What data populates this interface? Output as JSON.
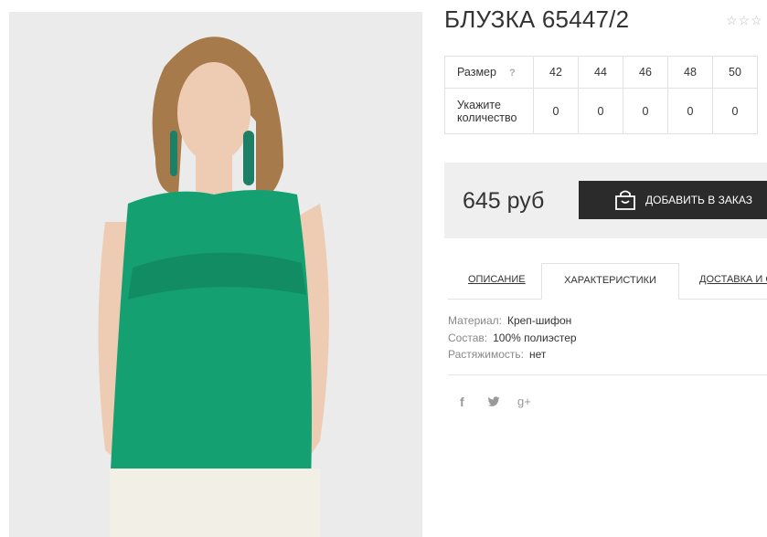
{
  "product": {
    "title": "БЛУЗКА 65447/2",
    "rating_stars": "☆☆☆",
    "rating_value": 0
  },
  "size_table": {
    "size_label": "Размер",
    "help_icon": "?",
    "sizes": [
      "42",
      "44",
      "46",
      "48",
      "50"
    ],
    "qty_label_line1": "Укажите",
    "qty_label_line2": "количество",
    "quantities": [
      "0",
      "0",
      "0",
      "0",
      "0"
    ]
  },
  "price": {
    "value": "645 руб",
    "add_button_label": "ДОБАВИТЬ В ЗАКАЗ",
    "add_button_icon": "shopping-bag-icon"
  },
  "tabs": [
    {
      "label": "ОПИСАНИЕ",
      "active": false
    },
    {
      "label": "ХАРАКТЕРИСТИКИ",
      "active": true
    },
    {
      "label": "ДОСТАВКА И С",
      "active": false
    }
  ],
  "characteristics": [
    {
      "key": "Материал:",
      "value": "Креп-шифон"
    },
    {
      "key": "Состав:",
      "value": "100% полиэстер"
    },
    {
      "key": "Растяжимость:",
      "value": "нет"
    }
  ],
  "social": {
    "facebook": "f",
    "twitter": "twitter-icon",
    "googleplus": "g+"
  },
  "colors": {
    "blouse": "#15a072",
    "button": "#2b2b2b",
    "price_bg": "#efefef"
  }
}
